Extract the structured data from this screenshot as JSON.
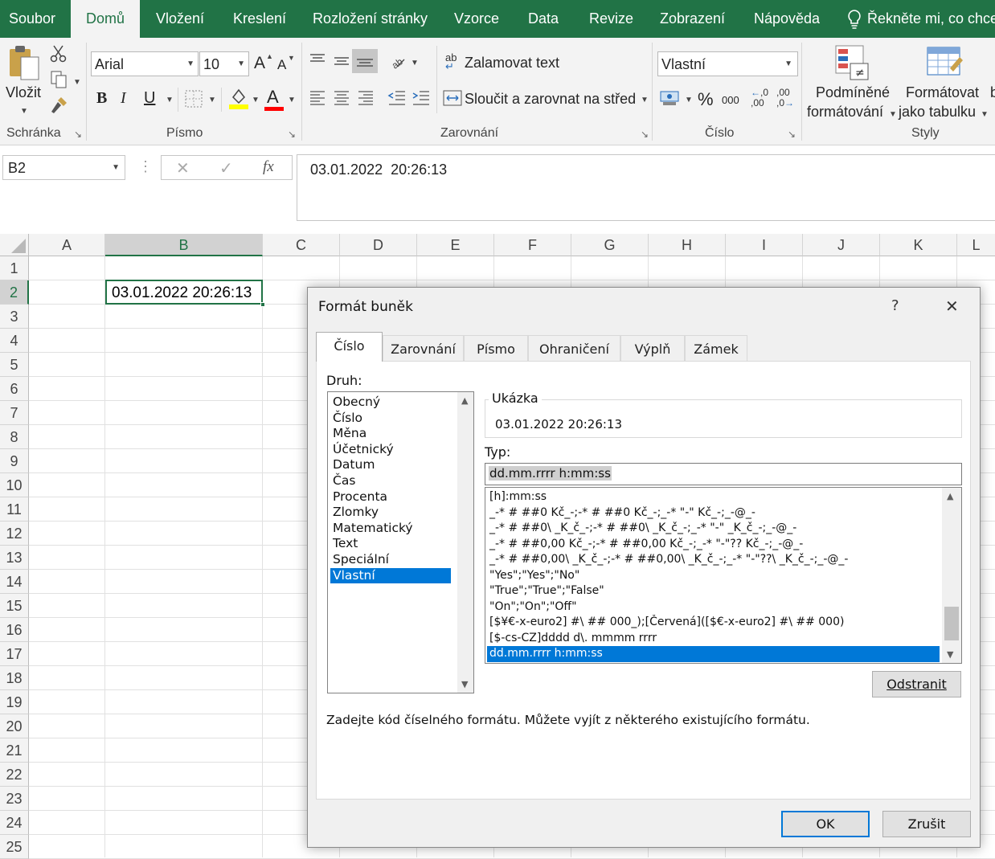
{
  "ribbon_tabs": [
    "Soubor",
    "Domů",
    "Vložení",
    "Kreslení",
    "Rozložení stránky",
    "Vzorce",
    "Data",
    "Revize",
    "Zobrazení",
    "Nápověda"
  ],
  "tell_me": "Řekněte mi, co chcete",
  "clipboard": {
    "paste_label": "Vložit",
    "group_label": "Schránka"
  },
  "font": {
    "name": "Arial",
    "size": "10",
    "grow": "A",
    "shrink": "A",
    "bold": "B",
    "italic": "I",
    "underline": "U",
    "font_color_letter": "A",
    "group_label": "Písmo",
    "highlight_color": "#ffff00",
    "font_color": "#ff0000"
  },
  "alignment": {
    "wrap_label": "Zalamovat text",
    "merge_label": "Sloučit a zarovnat na střed",
    "wrap_icon_text": "ab",
    "group_label": "Zarovnání"
  },
  "number": {
    "format_value": "Vlastní",
    "percent": "%",
    "thousands": "000",
    "inc_dec": ",0 ,00",
    "dec_dec": ",00 ,0",
    "group_label": "Číslo"
  },
  "styles": {
    "conditional_line1": "Podmíněné",
    "conditional_line2": "formátování",
    "table_line1": "Formátovat",
    "table_line2": "jako tabulku",
    "group_label": "Styly"
  },
  "formula_bar": {
    "name_box": "B2",
    "cancel": "✕",
    "enter": "✓",
    "fx": "fx",
    "content": "03.01.2022  20:26:13"
  },
  "grid": {
    "columns": [
      "A",
      "B",
      "C",
      "D",
      "E",
      "F",
      "G",
      "H",
      "I",
      "J",
      "K",
      "L"
    ],
    "rows": [
      "1",
      "2",
      "3",
      "4",
      "5",
      "6",
      "7",
      "8",
      "9",
      "10",
      "11",
      "12",
      "13",
      "14",
      "15",
      "16",
      "17",
      "18",
      "19",
      "20",
      "21",
      "22",
      "23",
      "24",
      "25"
    ],
    "active_cell": "B2",
    "cell_b2": "03.01.2022 20:26:13"
  },
  "dialog": {
    "title": "Formát buněk",
    "help": "?",
    "close": "✕",
    "tabs": [
      "Číslo",
      "Zarovnání",
      "Písmo",
      "Ohraničení",
      "Výplň",
      "Zámek"
    ],
    "category_label": "Druh:",
    "categories": [
      "Obecný",
      "Číslo",
      "Měna",
      "Účetnický",
      "Datum",
      "Čas",
      "Procenta",
      "Zlomky",
      "Matematický",
      "Text",
      "Speciální",
      "Vlastní"
    ],
    "selected_category": "Vlastní",
    "sample_label": "Ukázka",
    "sample_value": "03.01.2022 20:26:13",
    "type_label": "Typ:",
    "type_value": "dd.mm.rrrr h:mm:ss",
    "formats": [
      "[h]:mm:ss",
      "_-* # ##0 Kč_-;-* # ##0 Kč_-;_-* \"-\" Kč_-;_-@_-",
      "_-* # ##0\\ _K_č_-;-* # ##0\\ _K_č_-;_-* \"-\" _K_č_-;_-@_-",
      "_-* # ##0,00 Kč_-;-* # ##0,00 Kč_-;_-* \"-\"?? Kč_-;_-@_-",
      "_-* # ##0,00\\ _K_č_-;-* # ##0,00\\ _K_č_-;_-* \"-\"??\\ _K_č_-;_-@_-",
      "\"Yes\";\"Yes\";\"No\"",
      "\"True\";\"True\";\"False\"",
      "\"On\";\"On\";\"Off\"",
      "[$¥€-x-euro2] #\\ ## 000_);[Červená]([$€-x-euro2] #\\ ## 000)",
      "[$-cs-CZ]dddd d\\. mmmm rrrr",
      "dd.mm.rrrr h:mm:ss"
    ],
    "selected_format_index": 10,
    "delete_button": "Odstranit",
    "hint": "Zadejte kód číselného formátu. Můžete vyjít z některého existujícího formátu.",
    "ok": "OK",
    "cancel": "Zrušit"
  },
  "colors": {
    "excel_green": "#217346",
    "selection_blue": "#0078d7"
  }
}
